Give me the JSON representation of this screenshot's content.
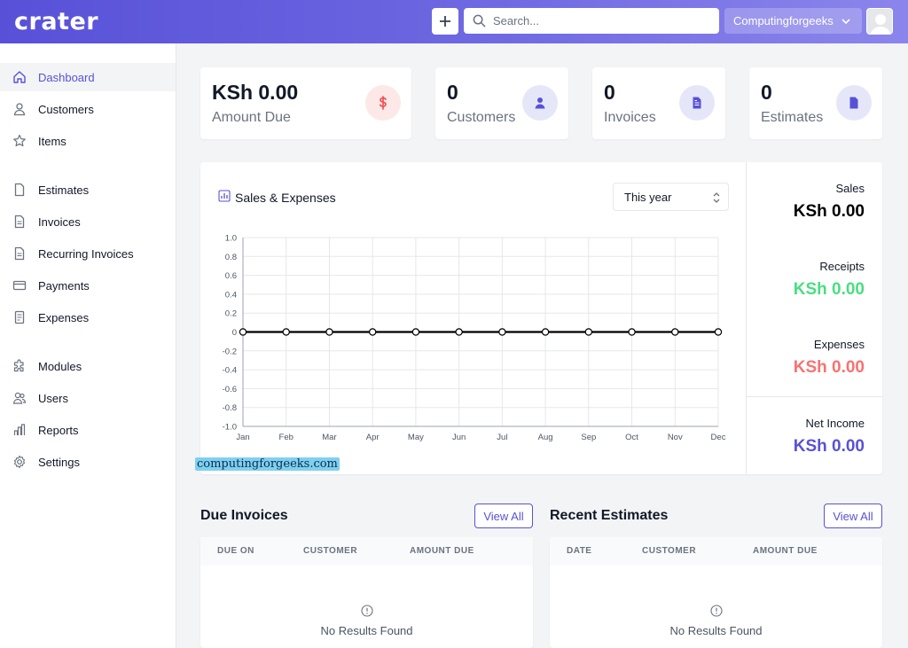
{
  "header": {
    "logo": "crater",
    "search_placeholder": "Search...",
    "company": "Computingforgeeks"
  },
  "sidebar": {
    "items": [
      {
        "label": "Dashboard",
        "icon": "home-icon"
      },
      {
        "label": "Customers",
        "icon": "user-icon"
      },
      {
        "label": "Items",
        "icon": "star-icon"
      },
      {
        "label": "Estimates",
        "icon": "document-icon"
      },
      {
        "label": "Invoices",
        "icon": "document-text-icon"
      },
      {
        "label": "Recurring Invoices",
        "icon": "document-text-icon"
      },
      {
        "label": "Payments",
        "icon": "credit-card-icon"
      },
      {
        "label": "Expenses",
        "icon": "receipt-icon"
      },
      {
        "label": "Modules",
        "icon": "puzzle-icon"
      },
      {
        "label": "Users",
        "icon": "users-icon"
      },
      {
        "label": "Reports",
        "icon": "chart-bar-icon"
      },
      {
        "label": "Settings",
        "icon": "gear-icon"
      }
    ]
  },
  "stats": [
    {
      "value": "KSh 0.00",
      "label": "Amount Due"
    },
    {
      "value": "0",
      "label": "Customers"
    },
    {
      "value": "0",
      "label": "Invoices"
    },
    {
      "value": "0",
      "label": "Estimates"
    }
  ],
  "chart_panel": {
    "title": "Sales & Expenses",
    "period": "This year",
    "summary": [
      {
        "label": "Sales",
        "value": "KSh 0.00",
        "color": "#000000"
      },
      {
        "label": "Receipts",
        "value": "KSh 0.00",
        "color": "#4ade80"
      },
      {
        "label": "Expenses",
        "value": "KSh 0.00",
        "color": "#f87171"
      },
      {
        "label": "Net Income",
        "value": "KSh 0.00",
        "color": "#5851d8"
      }
    ]
  },
  "chart_data": {
    "type": "line",
    "categories": [
      "Jan",
      "Feb",
      "Mar",
      "Apr",
      "May",
      "Jun",
      "Jul",
      "Aug",
      "Sep",
      "Oct",
      "Nov",
      "Dec"
    ],
    "series": [
      {
        "values": [
          0,
          0,
          0,
          0,
          0,
          0,
          0,
          0,
          0,
          0,
          0,
          0
        ]
      }
    ],
    "yticks": [
      "1.0",
      "0.8",
      "0.6",
      "0.4",
      "0.2",
      "0",
      "-0.2",
      "-0.4",
      "-0.6",
      "-0.8",
      "-1.0"
    ],
    "ylim": [
      -1.0,
      1.0
    ],
    "grid": true
  },
  "watermark": "computingforgeeks.com",
  "due_invoices": {
    "title": "Due Invoices",
    "view_all": "View All",
    "columns": [
      "DUE ON",
      "CUSTOMER",
      "AMOUNT DUE"
    ],
    "empty": "No Results Found"
  },
  "recent_estimates": {
    "title": "Recent Estimates",
    "view_all": "View All",
    "columns": [
      "DATE",
      "CUSTOMER",
      "AMOUNT DUE"
    ],
    "empty": "No Results Found"
  },
  "colors": {
    "brand": "#5851d8",
    "amount_due_icon_bg": "#fde8e8",
    "amount_due_icon": "#f05252",
    "stat_icon_bg": "#e5e7f9"
  }
}
